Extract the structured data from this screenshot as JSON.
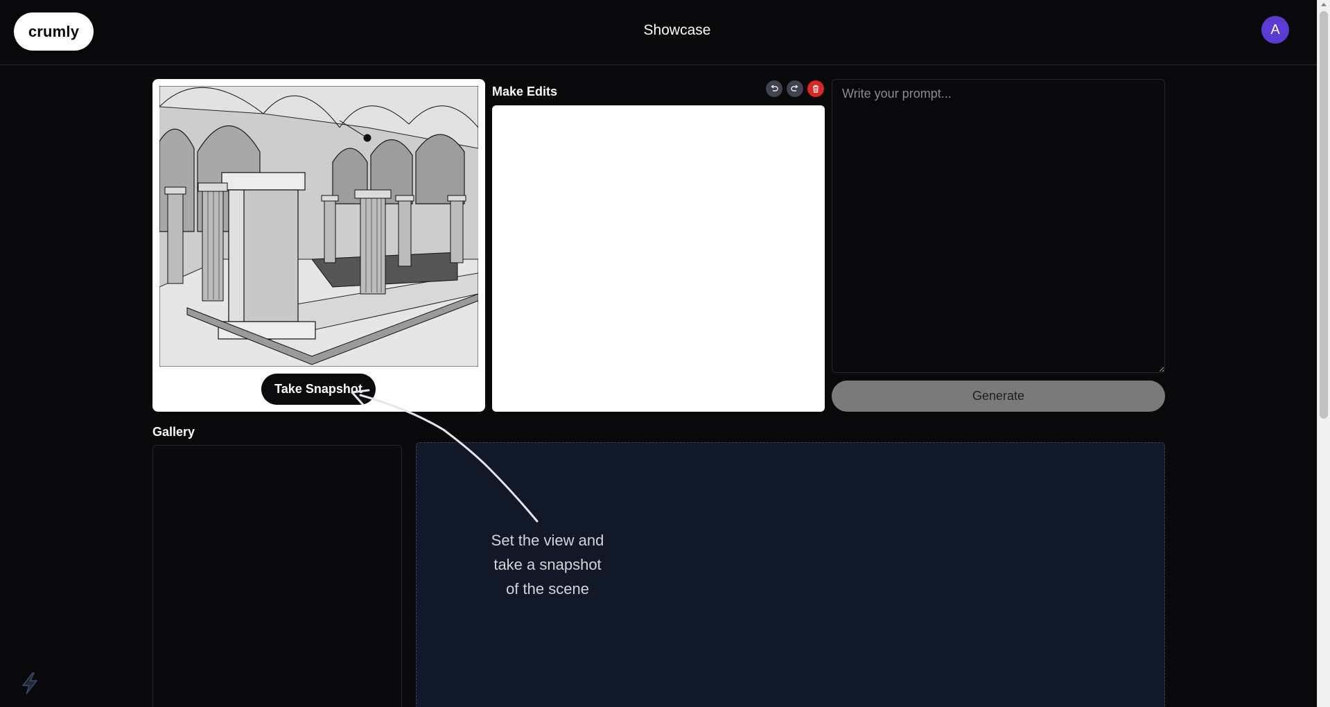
{
  "header": {
    "logo_text": "crumly",
    "title": "Showcase",
    "avatar_initial": "A"
  },
  "viewer": {
    "snapshot_label": "Take Snapshot"
  },
  "edits": {
    "title": "Make Edits",
    "tools": [
      "undo-icon",
      "redo-icon",
      "trash-icon"
    ]
  },
  "prompt": {
    "placeholder": "Write your prompt...",
    "value": "",
    "generate_label": "Generate"
  },
  "gallery": {
    "title": "Gallery",
    "hint_lines": [
      "Set the view and",
      "take a snapshot",
      "of the scene"
    ]
  },
  "colors": {
    "background": "#09090b",
    "avatar": "#5b3bd6",
    "clear_button": "#dc2626",
    "gallery_panel": "#111827",
    "generate_disabled": "#7a7a7a"
  }
}
